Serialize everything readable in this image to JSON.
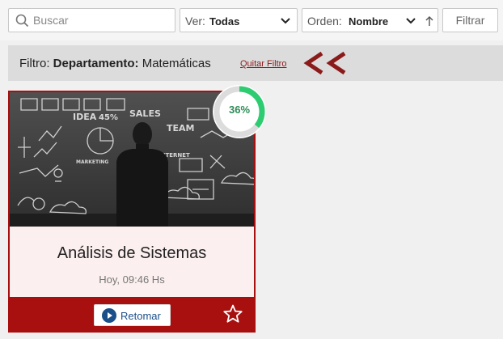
{
  "search": {
    "placeholder": "Buscar",
    "icon": "search-icon"
  },
  "ver": {
    "label": "Ver:",
    "value": "Todas"
  },
  "orden": {
    "label": "Orden:",
    "value": "Nombre"
  },
  "filter_button": "Filtrar",
  "filter_bar": {
    "prefix": "Filtro:",
    "key": "Departamento:",
    "value": "Matemáticas",
    "remove_link": "Quitar Filtro",
    "arrow_text": "<<"
  },
  "course": {
    "title": "Análisis de Sistemas",
    "time": "Hoy, 09:46 Hs",
    "resume_label": "Retomar",
    "progress_percent": 36,
    "progress_label": "36%",
    "board_text": [
      "IDEA",
      "45%",
      "SALES",
      "TEAM",
      "INTERNET",
      "MARKETING"
    ]
  },
  "colors": {
    "accent": "#a80f0f",
    "progress": "#2ecc71",
    "card_body": "#fcefef"
  }
}
